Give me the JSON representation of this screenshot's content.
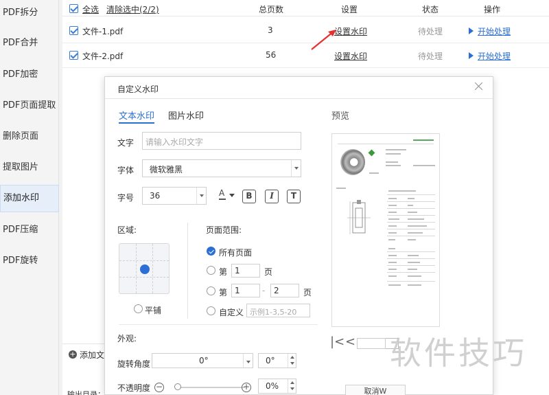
{
  "sidebar": {
    "items": [
      {
        "label": "PDF拆分"
      },
      {
        "label": "PDF合并"
      },
      {
        "label": "PDF加密"
      },
      {
        "label": "PDF页面提取"
      },
      {
        "label": "删除页面"
      },
      {
        "label": "提取图片"
      },
      {
        "label": "添加水印",
        "active": true
      },
      {
        "label": "PDF压缩"
      },
      {
        "label": "PDF旋转"
      }
    ]
  },
  "file_list": {
    "select_all": "全选",
    "clear_selection": "清除选中(2/2)",
    "columns": {
      "pages": "总页数",
      "settings": "设置",
      "status": "状态",
      "action": "操作"
    },
    "rows": [
      {
        "name": "文件-1.pdf",
        "pages": "3",
        "setting": "设置水印",
        "status": "待处理",
        "action": "开始处理"
      },
      {
        "name": "文件-2.pdf",
        "pages": "56",
        "setting": "设置水印",
        "status": "待处理",
        "action": "开始处理"
      }
    ],
    "add_file": "添加文件",
    "output_dir": "输出目录："
  },
  "dialog": {
    "title": "自定义水印",
    "tabs": [
      "文本水印",
      "图片水印"
    ],
    "text_label": "文字",
    "text_placeholder": "请输入水印文字",
    "font_label": "字体",
    "font_value": "微软雅黑",
    "size_label": "字号",
    "size_value": "36",
    "color_icon": "A",
    "bold": "B",
    "italic": "I",
    "text_t": "T",
    "region_label": "区域:",
    "tile_label": "平铺",
    "page_range_label": "页面范围:",
    "all_pages": "所有页面",
    "page_prefix": "第",
    "page_suffix": "页",
    "single_page": "1",
    "range_from": "1",
    "range_sep": "-",
    "range_to": "2",
    "custom_label": "自定义",
    "custom_placeholder": "示例1-3,5-20",
    "appearance_label": "外观:",
    "rotation_label": "旋转角度",
    "rotation_value": "0°",
    "rotation_spin": "0°",
    "opacity_label": "不透明度",
    "opacity_value": "0%",
    "opacity_level": 0,
    "minus": "−",
    "plus": "+",
    "preview_label": "预览",
    "first_page": "|<",
    "prev_page": "<"
  },
  "watermark_text": "软件技巧",
  "bottom_button": "取消W",
  "colors": {
    "accent": "#2b6fd6",
    "arrow": "#e53030"
  }
}
